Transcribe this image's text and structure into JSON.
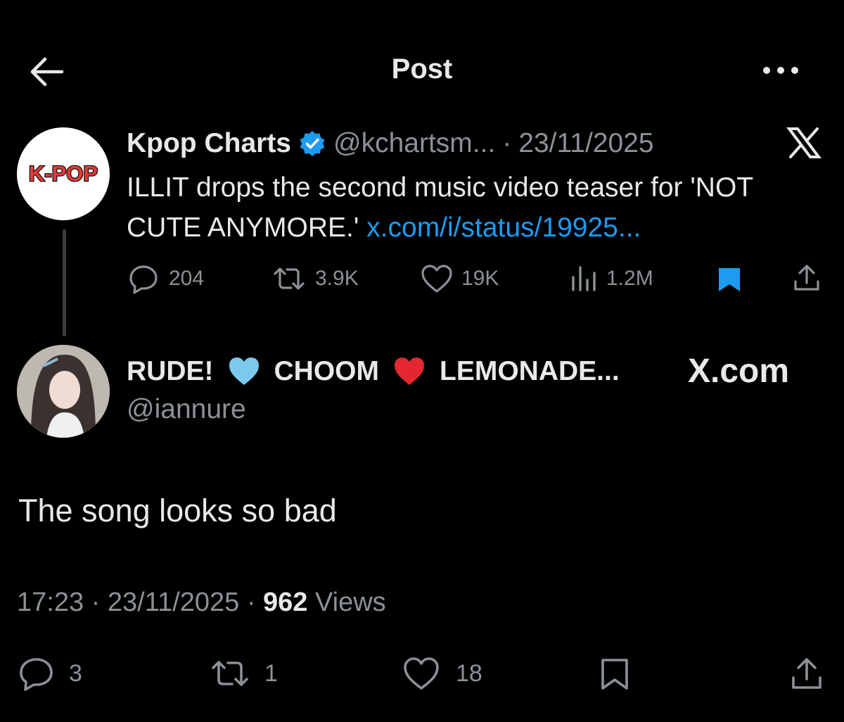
{
  "header": {
    "title": "Post"
  },
  "parent_post": {
    "avatar_text": "K-POP",
    "author_name": "Kpop Charts",
    "handle": "@kchartsm...",
    "separator": "·",
    "date": "23/11/2025",
    "text": "ILLIT drops the second music video teaser for 'NOT CUTE ANYMORE.'",
    "link": "x.com/i/status/19925...",
    "actions": {
      "replies": "204",
      "reposts": "3.9K",
      "likes": "19K",
      "views": "1.2M"
    },
    "bookmarked": true
  },
  "reply": {
    "name_part1": "RUDE!",
    "name_part2": "CHOOM",
    "name_part3": "LEMONADE...",
    "handle": "@iannure",
    "brand": "X.com",
    "text": "The song looks so bad",
    "time": "17:23",
    "date": "23/11/2025",
    "views_count": "962",
    "views_label": "Views",
    "separator": "·",
    "actions": {
      "replies": "3",
      "reposts": "1",
      "likes": "18"
    }
  },
  "colors": {
    "accent": "#1d9bf0",
    "muted": "#8b9197",
    "text": "#e7e9ea",
    "background": "#000000",
    "kpop_red": "#e53935"
  }
}
